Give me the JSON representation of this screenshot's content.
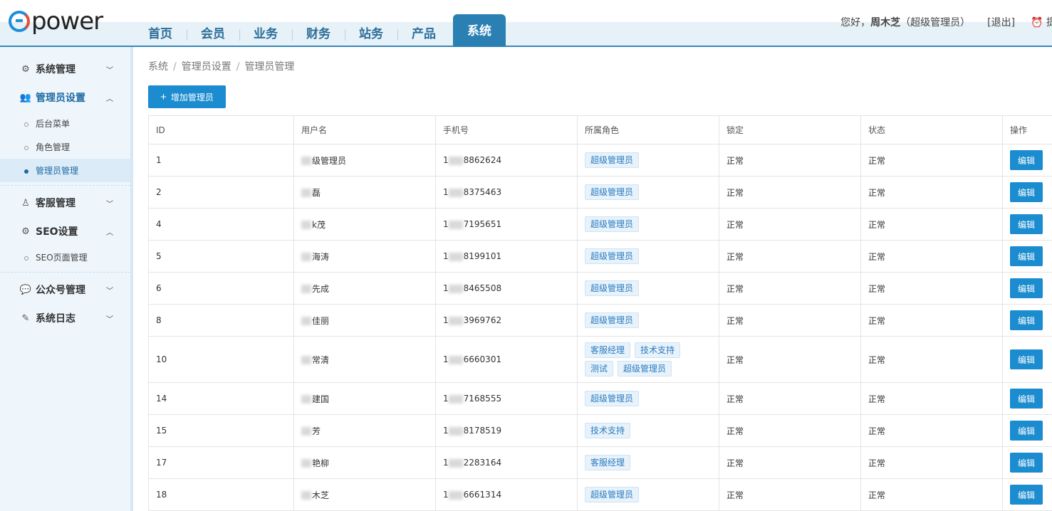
{
  "logo": {
    "text": "power"
  },
  "nav": {
    "items": [
      "首页",
      "会员",
      "业务",
      "财务",
      "站务",
      "产品",
      "系统"
    ],
    "active_index": 6
  },
  "user": {
    "greeting": "您好，",
    "name": "周木芝",
    "role": "（超级管理员）",
    "logout": "[退出]",
    "remind": "提"
  },
  "sidebar": {
    "groups": [
      {
        "label": "系统管理",
        "icon": "gears-icon",
        "expanded": false,
        "items": []
      },
      {
        "label": "管理员设置",
        "icon": "users-icon",
        "expanded": true,
        "items": [
          "后台菜单",
          "角色管理",
          "管理员管理"
        ]
      },
      {
        "label": "客服管理",
        "icon": "support-icon",
        "expanded": false,
        "items": []
      },
      {
        "label": "SEO设置",
        "icon": "gear-icon",
        "expanded": true,
        "items": [
          "SEO页面管理"
        ]
      },
      {
        "label": "公众号管理",
        "icon": "wechat-icon",
        "expanded": false,
        "items": []
      },
      {
        "label": "系统日志",
        "icon": "log-icon",
        "expanded": false,
        "items": []
      }
    ],
    "active_item": "管理员管理"
  },
  "breadcrumb": [
    "系统",
    "管理员设置",
    "管理员管理"
  ],
  "toolbar": {
    "add_label": "增加管理员"
  },
  "table": {
    "headers": [
      "ID",
      "用户名",
      "手机号",
      "所属角色",
      "锁定",
      "状态",
      "操作"
    ],
    "edit_label": "编辑",
    "rows": [
      {
        "id": "1",
        "name": "级管理员",
        "phone": "8862624",
        "roles": [
          "超级管理员"
        ],
        "lock": "正常",
        "status": "正常"
      },
      {
        "id": "2",
        "name": "磊",
        "phone": "8375463",
        "roles": [
          "超级管理员"
        ],
        "lock": "正常",
        "status": "正常"
      },
      {
        "id": "4",
        "name": "k茂",
        "phone": "7195651",
        "roles": [
          "超级管理员"
        ],
        "lock": "正常",
        "status": "正常"
      },
      {
        "id": "5",
        "name": "海涛",
        "phone": "8199101",
        "roles": [
          "超级管理员"
        ],
        "lock": "正常",
        "status": "正常"
      },
      {
        "id": "6",
        "name": "先成",
        "phone": "8465508",
        "roles": [
          "超级管理员"
        ],
        "lock": "正常",
        "status": "正常"
      },
      {
        "id": "8",
        "name": "佳丽",
        "phone": "3969762",
        "roles": [
          "超级管理员"
        ],
        "lock": "正常",
        "status": "正常"
      },
      {
        "id": "10",
        "name": "常清",
        "phone": "6660301",
        "roles": [
          "客服经理",
          "技术支持",
          "测试",
          "超级管理员"
        ],
        "lock": "正常",
        "status": "正常"
      },
      {
        "id": "14",
        "name": "建国",
        "phone": "7168555",
        "roles": [
          "超级管理员"
        ],
        "lock": "正常",
        "status": "正常"
      },
      {
        "id": "15",
        "name": "芳",
        "phone": "8178519",
        "roles": [
          "技术支持"
        ],
        "lock": "正常",
        "status": "正常"
      },
      {
        "id": "17",
        "name": "艳柳",
        "phone": "2283164",
        "roles": [
          "客服经理"
        ],
        "lock": "正常",
        "status": "正常"
      },
      {
        "id": "18",
        "name": "木芝",
        "phone": "6661314",
        "roles": [
          "超级管理员"
        ],
        "lock": "正常",
        "status": "正常"
      }
    ]
  }
}
